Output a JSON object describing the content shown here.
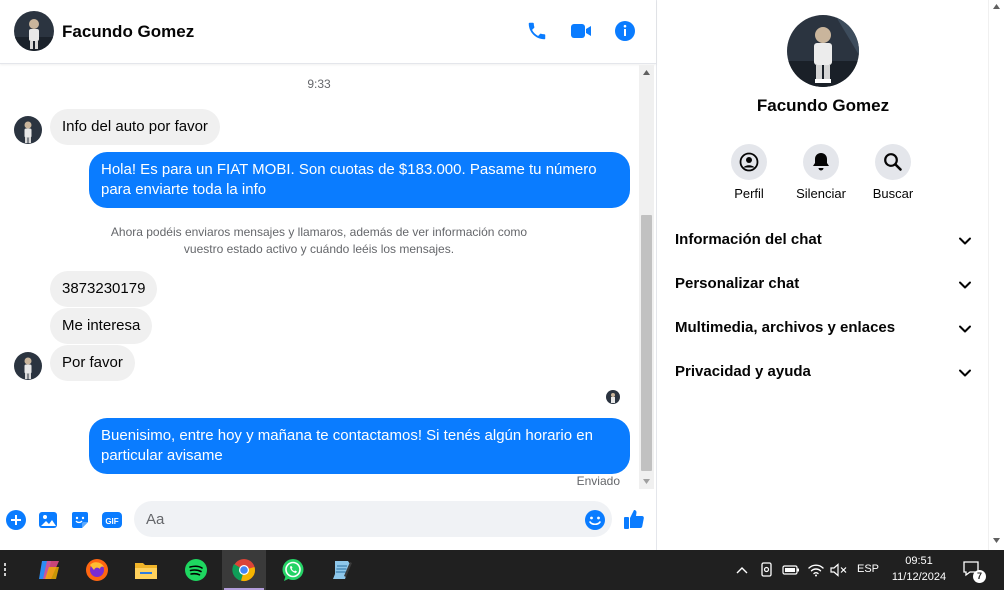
{
  "header": {
    "contact_name": "Facundo Gomez",
    "call_icon": "phone-icon",
    "video_icon": "video-camera-icon",
    "info_icon": "info-icon"
  },
  "messages": {
    "timestamp": "9:33",
    "incoming_1": "Info del auto por favor",
    "outgoing_1": "Hola! Es para un FIAT MOBI. Son cuotas de $183.000. Pasame tu número para enviarte toda la info",
    "notice": "Ahora podéis enviaros mensajes y llamaros, además de ver información como vuestro estado activo y cuándo leéis los mensajes.",
    "incoming_2": "3873230179",
    "incoming_3": "Me interesa",
    "incoming_4": "Por favor",
    "outgoing_2": "Buenisimo, entre hoy y mañana te contactamos! Si tenés algún horario en particular avisame",
    "status": "Enviado"
  },
  "composer": {
    "placeholder": "Aa",
    "icons": [
      "plus-icon",
      "image-icon",
      "sticker-icon",
      "gif-icon",
      "emoji-icon",
      "like-icon"
    ]
  },
  "info_panel": {
    "name": "Facundo Gomez",
    "actions": [
      {
        "label": "Perfil",
        "icon": "profile-icon"
      },
      {
        "label": "Silenciar",
        "icon": "bell-icon"
      },
      {
        "label": "Buscar",
        "icon": "search-icon"
      }
    ],
    "sections": [
      {
        "label": "Información del chat"
      },
      {
        "label": "Personalizar chat"
      },
      {
        "label": "Multimedia, archivos y enlaces"
      },
      {
        "label": "Privacidad y ayuda"
      }
    ]
  },
  "taskbar": {
    "apps": [
      "copilot-icon",
      "firefox-icon",
      "file-explorer-icon",
      "spotify-icon",
      "chrome-icon",
      "whatsapp-icon",
      "notepad-icon"
    ],
    "language": "ESP",
    "time": "09:51",
    "date": "11/12/2024",
    "notification_count": "7"
  },
  "colors": {
    "accent": "#0a7cff",
    "incoming_bubble": "#f0f0f0",
    "taskbar": "#202020"
  }
}
